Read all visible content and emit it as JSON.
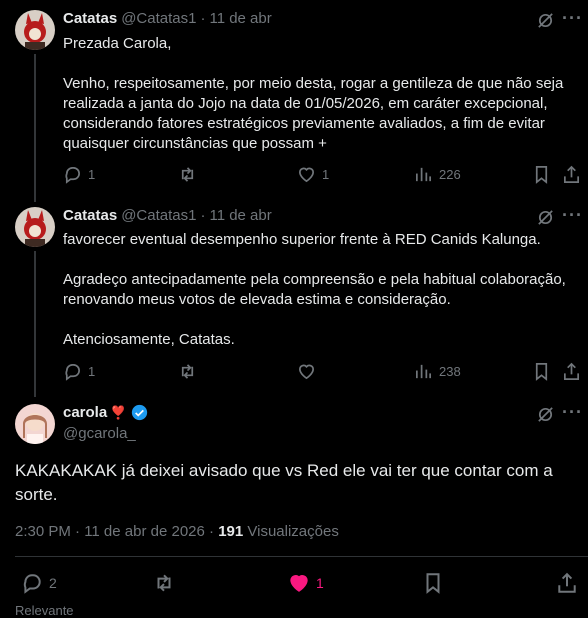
{
  "tweets": [
    {
      "name": "Catatas",
      "handle": "@Catatas1",
      "sep": "·",
      "date": "11 de abr",
      "text": "Prezada Carola,\n\nVenho, respeitosamente, por meio desta, rogar a gentileza de que não seja realizada a janta do Jojo na data de 01/05/2026, em caráter excepcional, considerando fatores estratégicos previamente avaliados, a fim de evitar quaisquer circunstâncias que possam +",
      "replies": "1",
      "retweets": "",
      "likes": "1",
      "views": "226"
    },
    {
      "name": "Catatas",
      "handle": "@Catatas1",
      "sep": "·",
      "date": "11 de abr",
      "text": "favorecer eventual desempenho superior frente à RED Canids Kalunga.\n\nAgradeço antecipadamente pela compreensão e pela habitual colaboração, renovando meus votos de elevada estima e consideração.\n\nAtenciosamente, Catatas.",
      "replies": "1",
      "retweets": "",
      "likes": "",
      "views": "238"
    }
  ],
  "main": {
    "name": "carola",
    "emoji": "❣️",
    "handle": "@gcarola_",
    "text": "KAKAKAKAK já deixei avisado que vs Red ele vai ter que contar com a sorte.",
    "time": "2:30 PM · 11 de abr de 2026 ·",
    "views_count": "191",
    "views_label": "Visualizações",
    "replies": "2",
    "likes": "1"
  },
  "footer": {
    "label": "Relevante"
  },
  "colors": {
    "like_active": "#f91880",
    "verified": "#1d9bf0",
    "muted": "#71767b"
  }
}
